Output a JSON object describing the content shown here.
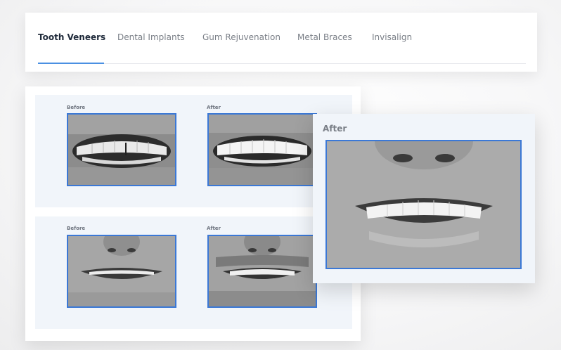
{
  "tabs": [
    {
      "label": "Tooth Veneers",
      "active": true
    },
    {
      "label": "Dental Implants",
      "active": false
    },
    {
      "label": "Gum Rejuvenation",
      "active": false
    },
    {
      "label": "Metal Braces",
      "active": false
    },
    {
      "label": "Invisalign",
      "active": false
    }
  ],
  "gallery": {
    "rows": [
      {
        "before_label": "Before",
        "after_label": "After"
      },
      {
        "before_label": "Before",
        "after_label": "After"
      }
    ]
  },
  "popup": {
    "title": "After"
  },
  "colors": {
    "accent": "#4a90e2",
    "photo_border": "#3b78d6",
    "panel_bg": "#f1f5fa"
  }
}
